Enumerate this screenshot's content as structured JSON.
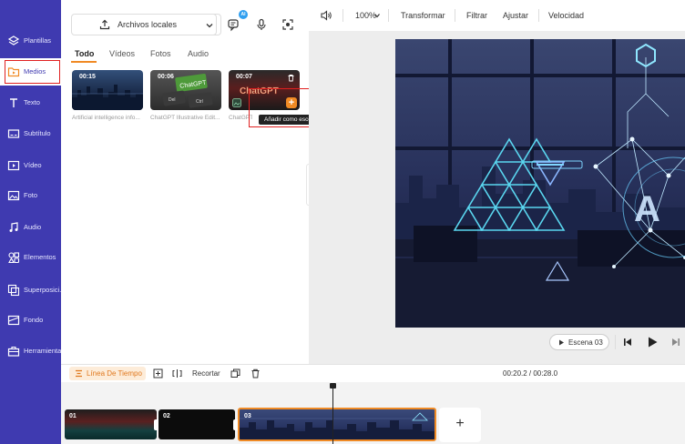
{
  "sidebar": {
    "items": [
      {
        "label": "Plantillas",
        "icon": "layers-icon"
      },
      {
        "label": "Medios",
        "icon": "folder-icon"
      },
      {
        "label": "Texto",
        "icon": "text-icon"
      },
      {
        "label": "Subtítulo",
        "icon": "subtitle-icon"
      },
      {
        "label": "Vídeo",
        "icon": "video-icon"
      },
      {
        "label": "Foto",
        "icon": "photo-icon"
      },
      {
        "label": "Audio",
        "icon": "music-icon"
      },
      {
        "label": "Elementos",
        "icon": "elements-icon"
      },
      {
        "label": "Superposici...",
        "icon": "overlay-icon"
      },
      {
        "label": "Fondo",
        "icon": "background-icon"
      },
      {
        "label": "Herramientas",
        "icon": "toolbox-icon"
      }
    ],
    "active_index": 1
  },
  "media": {
    "source_label": "Archivos locales",
    "ai_badge": "AI",
    "tabs": [
      "Todo",
      "Vídeos",
      "Fotos",
      "Audio"
    ],
    "active_tab": 0,
    "items": [
      {
        "duration": "00:15",
        "caption": "Artificial intelligence info..."
      },
      {
        "duration": "00:06",
        "caption": "ChatGPT Illustrative Edit..."
      },
      {
        "duration": "00:07",
        "caption": "ChatGPT ..."
      }
    ],
    "tooltip": "Añadir como escena"
  },
  "toolbar": {
    "zoom": "100%",
    "transform": "Transformar",
    "filter": "Filtrar",
    "adjust": "Ajustar",
    "speed": "Velocidad"
  },
  "preview": {
    "scene_label": "Escena 03"
  },
  "timeline": {
    "title": "Línea De Tiempo",
    "trim": "Recortar",
    "time": "00:20.2 / 00:28.0",
    "clips": [
      "01",
      "02",
      "03"
    ],
    "add": "+"
  },
  "colors": {
    "sidebar": "#3f3ab0",
    "accent": "#f08a24",
    "highlight": "#e02020"
  }
}
